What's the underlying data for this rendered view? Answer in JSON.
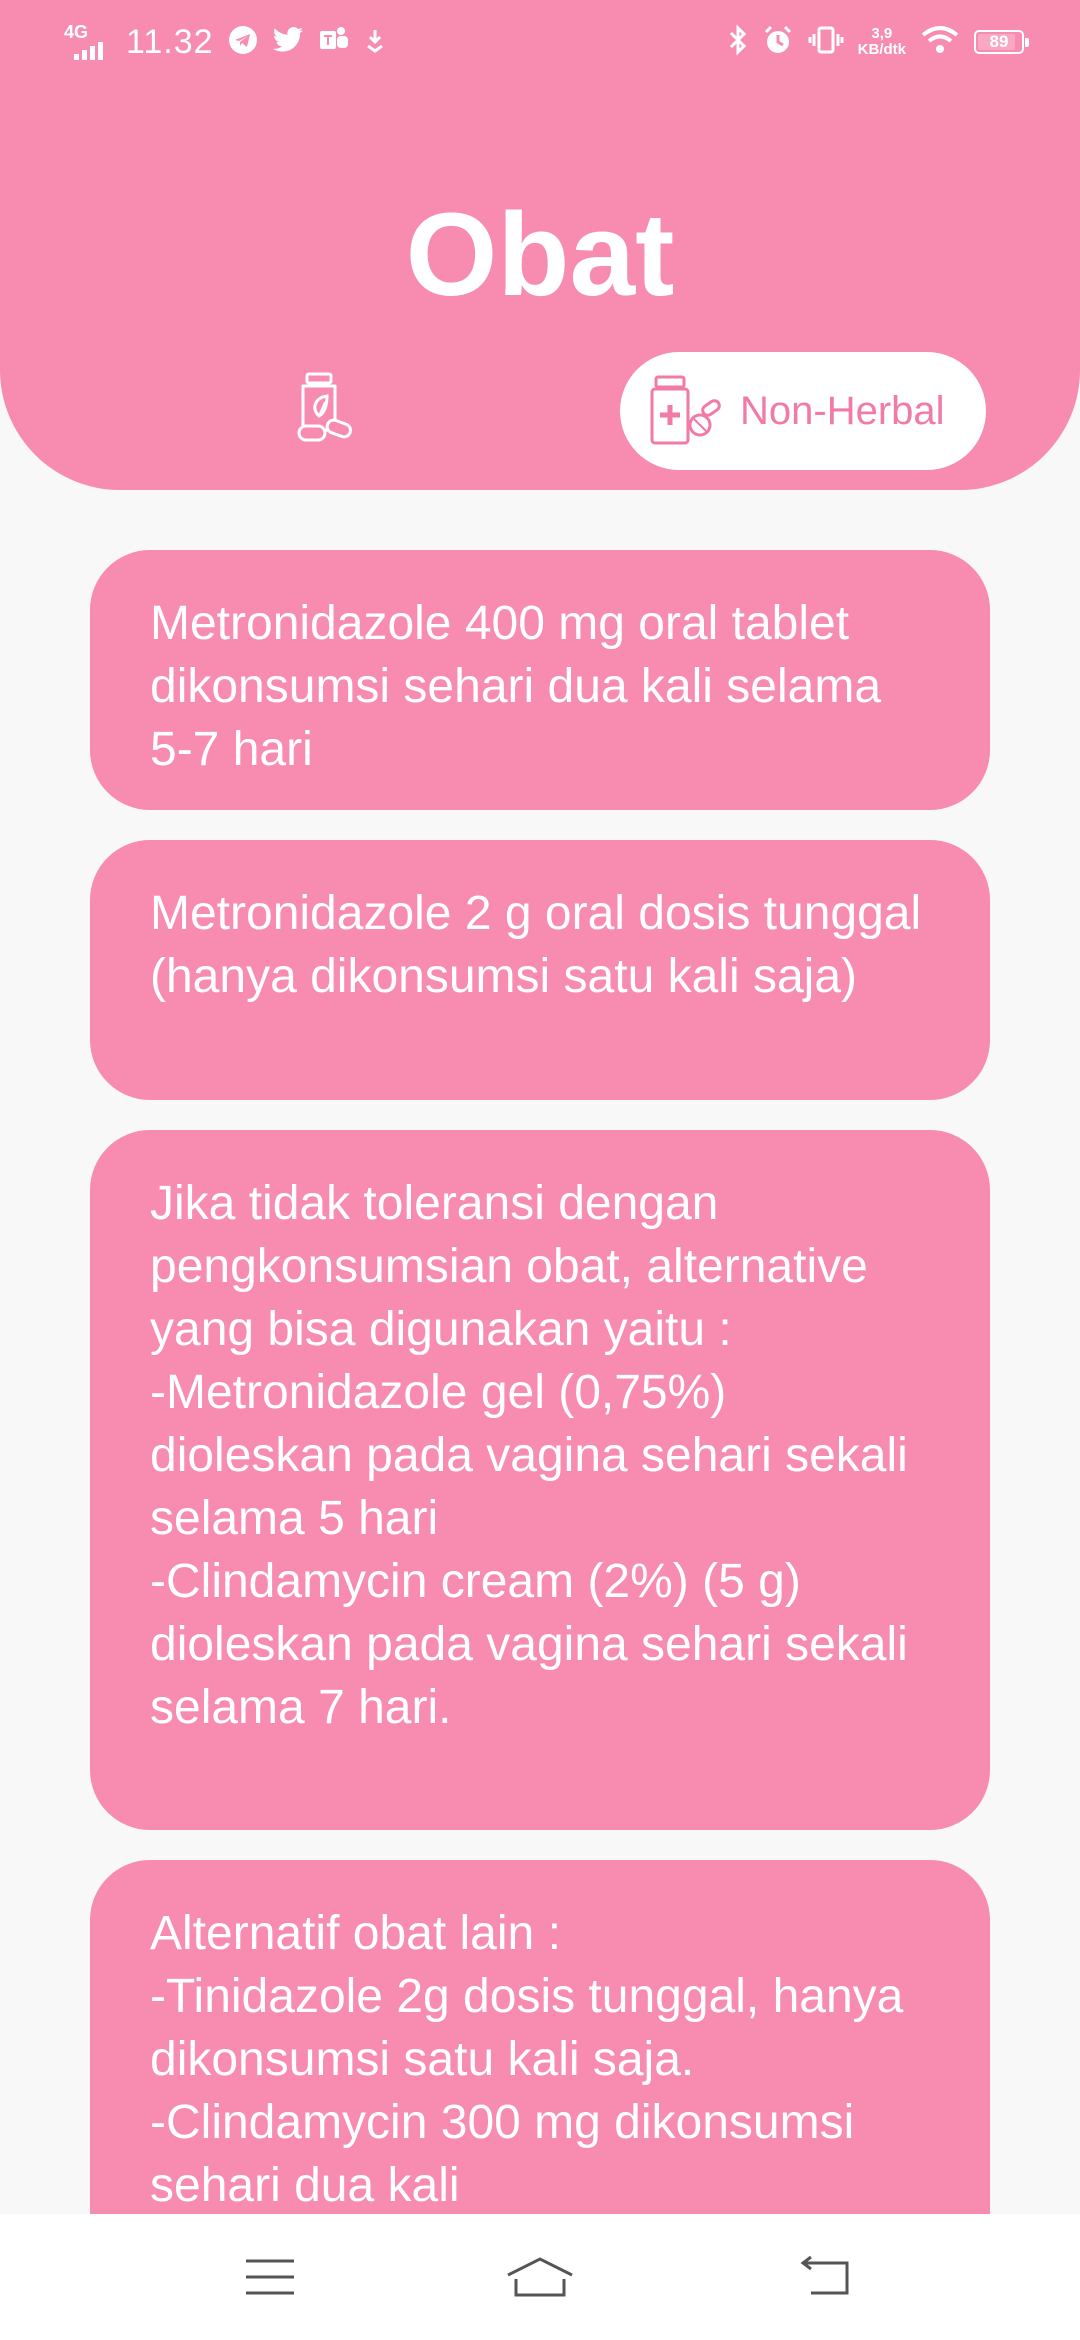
{
  "status_bar": {
    "network": "4G",
    "time": "11.32",
    "speed_value": "3,9",
    "speed_unit": "KB/dtk",
    "battery": "89",
    "battery_level_percent": 89
  },
  "header": {
    "title": "Obat"
  },
  "tabs": [
    {
      "label": "",
      "icon": "herbal-jar-icon"
    },
    {
      "label": "Non-Herbal",
      "icon": "medicine-bottle-icon",
      "selected": true
    }
  ],
  "cards": [
    {
      "text": "Metronidazole 400 mg oral tablet dikonsumsi sehari dua kali selama 5-7 hari"
    },
    {
      "text": "Metronidazole 2 g oral dosis tunggal (hanya dikonsumsi satu kali saja)"
    },
    {
      "text": "Jika tidak toleransi dengan pengkonsumsian obat, alternative yang bisa digunakan yaitu :\n-Metronidazole gel (0,75%) dioleskan pada vagina sehari sekali selama 5 hari\n-Clindamycin cream (2%) (5 g) dioleskan pada vagina sehari sekali selama 7 hari."
    },
    {
      "text": "Alternatif obat lain :\n-Tinidazole 2g dosis tunggal, hanya dikonsumsi satu kali saja.\n-Clindamycin 300 mg dikonsumsi sehari dua kali"
    }
  ],
  "navigation": {
    "menu_icon": "menu-icon",
    "home_icon": "home-icon",
    "back_icon": "back-icon"
  },
  "colors": {
    "accent": "#f78bb0",
    "accent_text": "#f27aa6",
    "background": "#f8f8f8"
  }
}
